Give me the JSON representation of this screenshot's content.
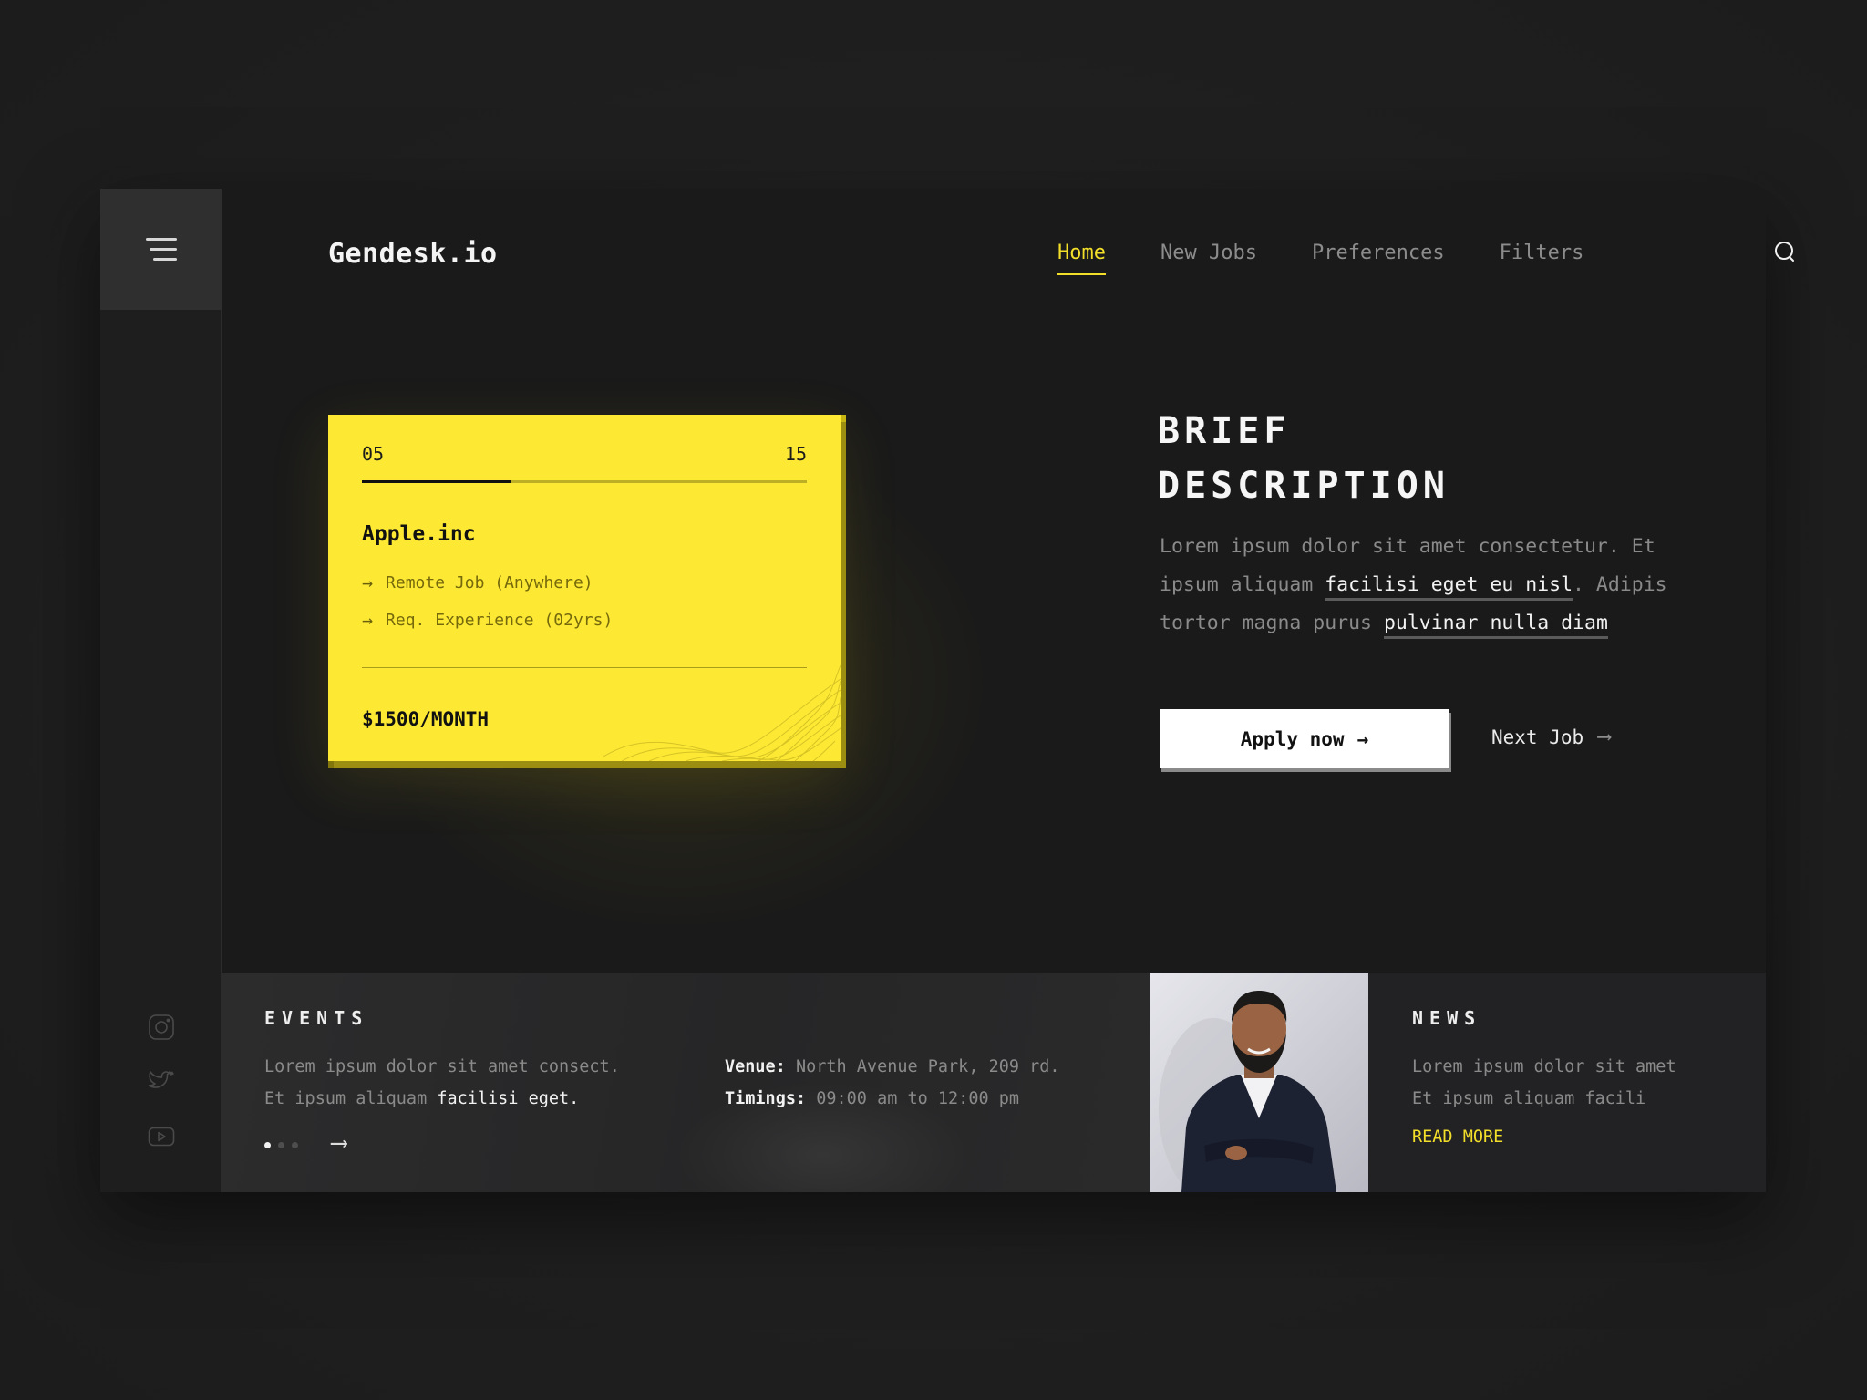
{
  "brand": "Gendesk.io",
  "colors": {
    "accent": "#f3df2a",
    "card": "#fde934",
    "background": "#1a1a1a"
  },
  "nav": {
    "items": [
      {
        "label": "Home",
        "active": true
      },
      {
        "label": "New Jobs",
        "active": false
      },
      {
        "label": "Preferences",
        "active": false
      },
      {
        "label": "Filters",
        "active": false
      }
    ],
    "search_icon": "search-icon",
    "menu_icon": "hamburger-menu-icon"
  },
  "job_card": {
    "current": "05",
    "total": "15",
    "progress_fraction": 0.333,
    "company": "Apple.inc",
    "features": [
      "Remote Job (Anywhere)",
      "Req. Experience (02yrs)"
    ],
    "feature_icon": "→",
    "salary": "$1500/MONTH"
  },
  "description": {
    "title_line1": "BRIEF",
    "title_line2": "DESCRIPTION",
    "text_1": "Lorem ipsum dolor sit amet consectetur. Et ipsum aliquam ",
    "highlight_1": "facilisi eget eu nisl",
    "text_2": ". Adipis tortor magna purus ",
    "highlight_2": "pulvinar nulla diam"
  },
  "actions": {
    "apply_label": "Apply now",
    "apply_icon": "→",
    "next_label": "Next Job",
    "next_icon": "⟶"
  },
  "events": {
    "title": "EVENTS",
    "line1": "Lorem ipsum dolor sit amet consect.",
    "line2_prefix": "Et ipsum aliquam ",
    "line2_highlight": "facilisi eget.",
    "venue_label": "Venue:",
    "venue_value": "North Avenue Park, 209 rd.",
    "timings_label": "Timings:",
    "timings_value": "09:00 am to 12:00 pm",
    "pager": {
      "count": 3,
      "active": 0
    },
    "next_icon": "⟶"
  },
  "news": {
    "title": "NEWS",
    "line1": "Lorem ipsum dolor sit amet",
    "line2": "Et ipsum aliquam facili",
    "read_more": "READ MORE",
    "photo_alt": "smiling bearded man with crossed arms"
  },
  "socials": [
    "instagram-icon",
    "twitter-icon",
    "youtube-icon"
  ]
}
